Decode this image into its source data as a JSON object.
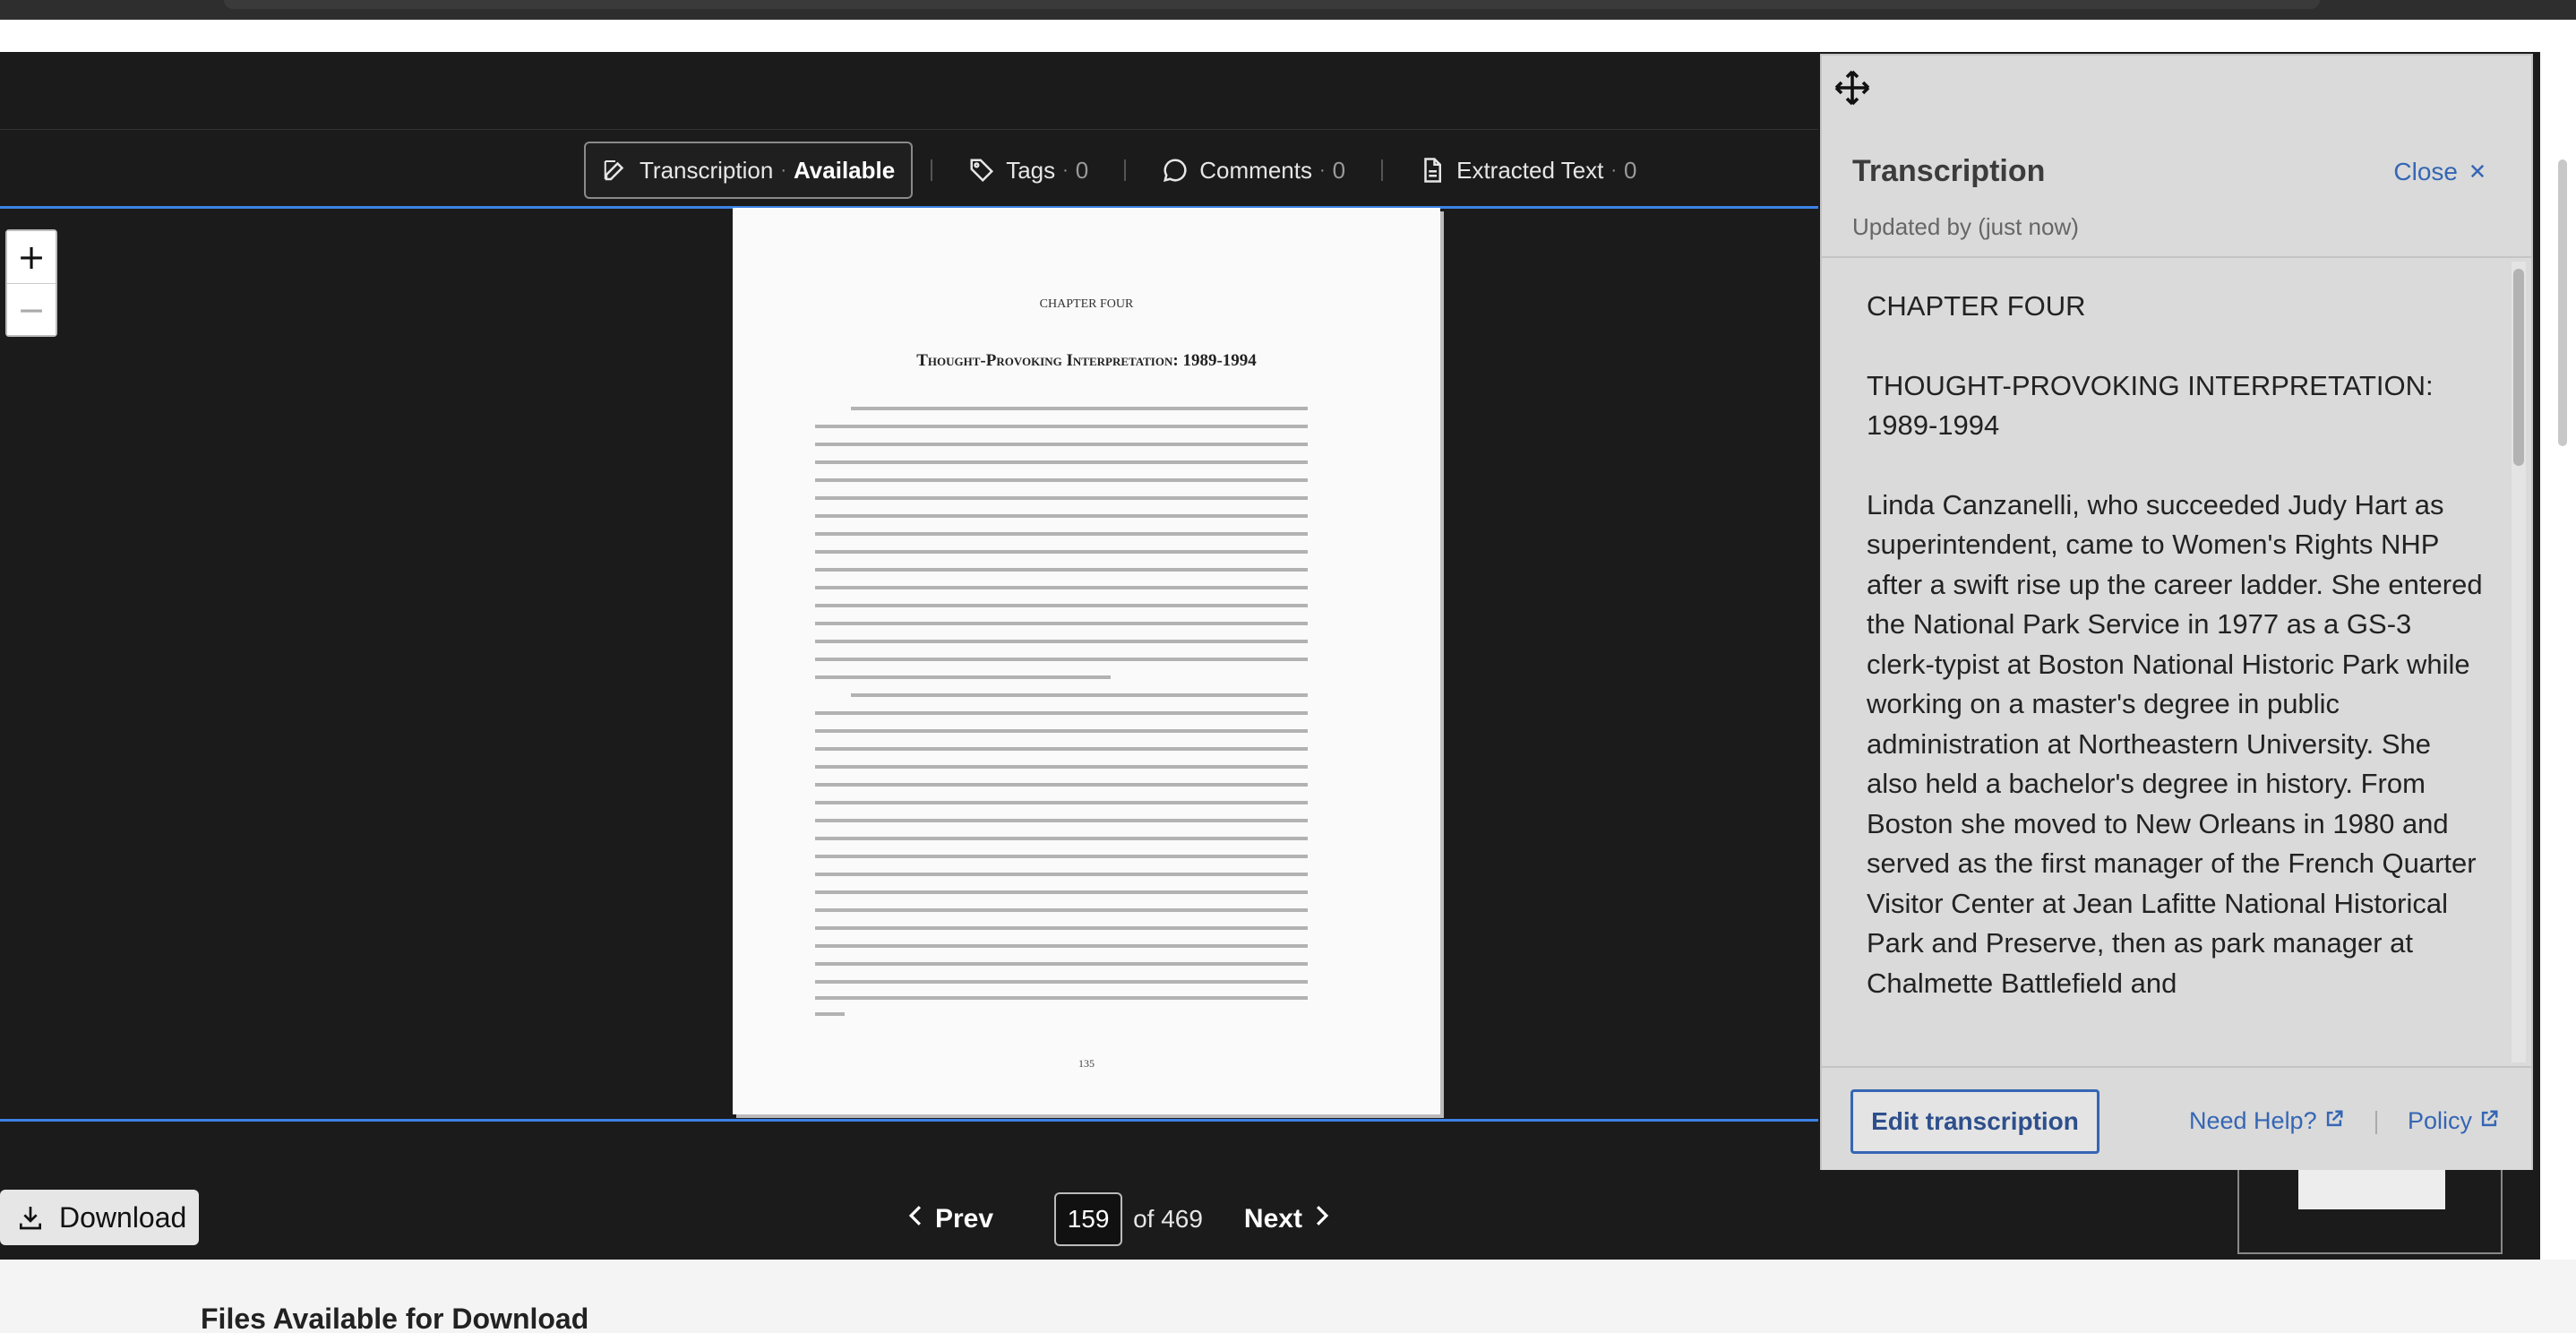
{
  "toolbar": {
    "transcription_label": "Transcription",
    "transcription_status": "Available",
    "tags_label": "Tags",
    "tags_count": "0",
    "comments_label": "Comments",
    "comments_count": "0",
    "extracted_label": "Extracted Text",
    "extracted_count": "0"
  },
  "zoom": {
    "in_label": "+",
    "out_label": "−"
  },
  "page_image": {
    "chapter": "CHAPTER FOUR",
    "title": "Thought-Provoking Interpretation: 1989-1994",
    "page_number": "135"
  },
  "pager": {
    "prev_label": "Prev",
    "current_page": "159",
    "of_label": "of 469",
    "next_label": "Next"
  },
  "download": {
    "label": "Download"
  },
  "footer": {
    "heading": "Files Available for Download"
  },
  "panel": {
    "title": "Transcription",
    "close_label": "Close",
    "updated": "Updated by (just now)",
    "paragraphs": [
      "CHAPTER FOUR",
      "THOUGHT-PROVOKING INTERPRETATION: 1989-1994",
      "Linda Canzanelli, who succeeded Judy Hart as superintendent, came to Women's Rights NHP after a swift rise up the career ladder. She entered the National Park Service in 1977 as a GS-3 clerk-typist at Boston National Historic Park while working on a master's degree in public administration at Northeastern University. She also held a bachelor's degree in history. From Boston she moved to New Orleans in 1980 and served as the first manager of the French Quarter Visitor Center at Jean Lafitte National Historical Park and Preserve, then as park manager at Chalmette Battlefield and"
    ],
    "edit_label": "Edit transcription",
    "help_label": "Need Help?",
    "policy_label": "Policy"
  },
  "icons": {
    "move": "move-icon",
    "edit": "pencil-icon",
    "tag": "tag-icon",
    "comment": "comment-icon",
    "document": "document-icon",
    "close": "close-icon",
    "download": "download-icon",
    "external": "external-link-icon",
    "chevron_left": "chevron-left-icon",
    "chevron_right": "chevron-right-icon"
  },
  "colors": {
    "accent_link": "#3566b4",
    "frame_highlight": "#3b82e6",
    "viewer_bg": "#1b1b1b",
    "panel_bg": "#dadada"
  }
}
